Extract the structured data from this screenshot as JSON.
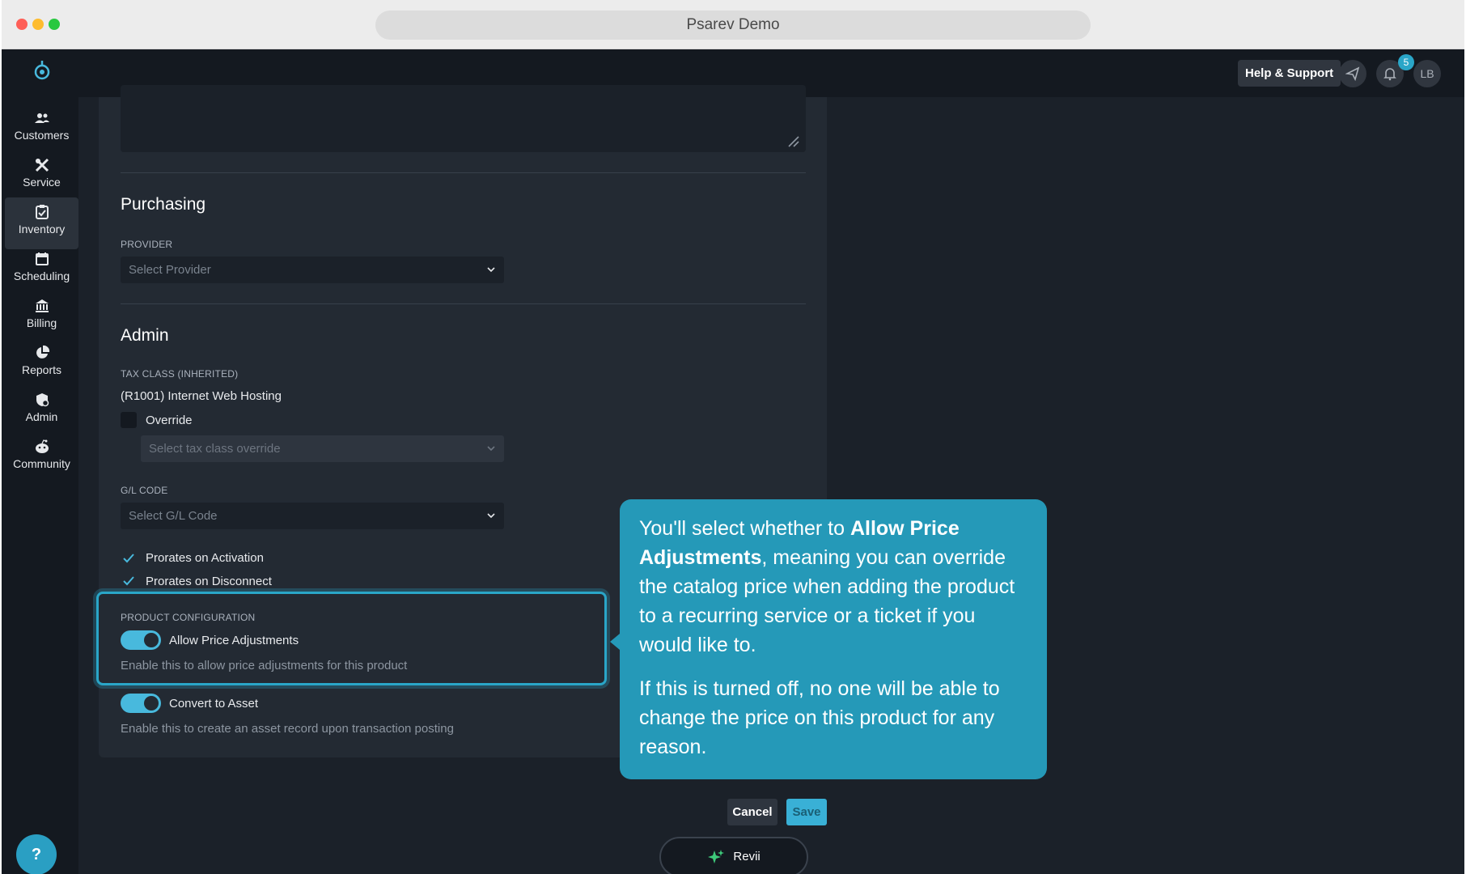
{
  "window": {
    "title": "Psarev Demo"
  },
  "header": {
    "help_label": "Help & Support",
    "notification_count": "5",
    "avatar_initials": "LB"
  },
  "sidebar": {
    "items": [
      {
        "label": "Customers",
        "icon": "customers-icon"
      },
      {
        "label": "Service",
        "icon": "service-icon"
      },
      {
        "label": "Inventory",
        "icon": "inventory-icon",
        "active": true
      },
      {
        "label": "Scheduling",
        "icon": "calendar-icon"
      },
      {
        "label": "Billing",
        "icon": "bank-icon"
      },
      {
        "label": "Reports",
        "icon": "pie-chart-icon"
      },
      {
        "label": "Admin",
        "icon": "admin-icon"
      },
      {
        "label": "Community",
        "icon": "community-icon"
      }
    ],
    "help_button": "?"
  },
  "form": {
    "purchasing": {
      "title": "Purchasing",
      "provider_label": "PROVIDER",
      "provider_placeholder": "Select Provider"
    },
    "admin": {
      "title": "Admin",
      "tax_class_label": "TAX CLASS (INHERITED)",
      "tax_class_value": "(R1001) Internet Web Hosting",
      "override_label": "Override",
      "tax_override_placeholder": "Select tax class override",
      "gl_code_label": "G/L CODE",
      "gl_code_placeholder": "Select G/L Code",
      "prorates_activation": "Prorates on Activation",
      "prorates_disconnect": "Prorates on Disconnect"
    },
    "product_config": {
      "label": "PRODUCT CONFIGURATION",
      "allow_price_label": "Allow Price Adjustments",
      "allow_price_help": "Enable this to allow price adjustments for this product",
      "convert_asset_label": "Convert to Asset",
      "convert_asset_help": "Enable this to create an asset record upon transaction posting"
    }
  },
  "tooltip": {
    "p1_a": "You'll select whether to ",
    "p1_bold": "Allow Price Adjustments",
    "p1_b": ", meaning you can override the catalog price when adding the product to a recurring service or a ticket if you would like to.",
    "p2": "If this is turned off, no one will be able to change the price on this product for any reason."
  },
  "actions": {
    "cancel": "Cancel",
    "save": "Save"
  },
  "revii": {
    "label": "Revii"
  },
  "colors": {
    "accent": "#2aa6c8",
    "tooltip_bg": "#2599b8",
    "toggle_on": "#48b9dd",
    "panel": "#232a33"
  }
}
